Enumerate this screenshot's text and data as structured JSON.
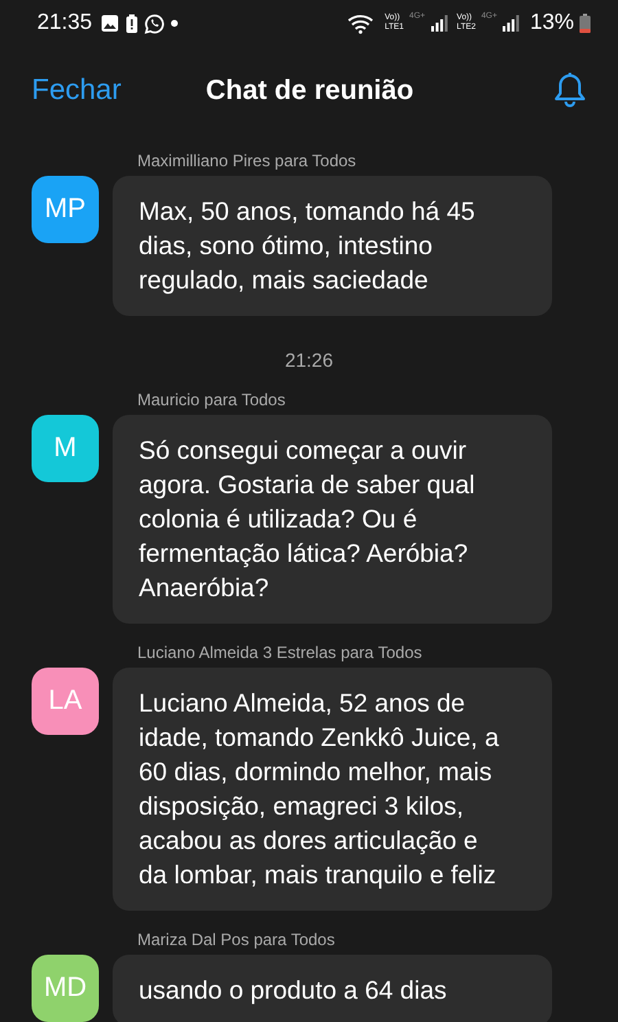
{
  "status_bar": {
    "time": "21:35",
    "network": [
      {
        "volte": "Vo))",
        "lte": "LTE1",
        "gen": "4G+"
      },
      {
        "volte": "Vo))",
        "lte": "LTE2",
        "gen": "4G+"
      }
    ],
    "battery": "13%"
  },
  "header": {
    "close": "Fechar",
    "title": "Chat de reunião"
  },
  "feed": [
    {
      "kind": "message",
      "sender": "Maximilliano Pires para Todos",
      "initials": "MP",
      "color": "#1aa3f5",
      "text": "Max, 50 anos, tomando há 45 dias, sono ótimo, intestino regulado, mais saciedade"
    },
    {
      "kind": "time",
      "text": "21:26"
    },
    {
      "kind": "message",
      "sender": "Mauricio para Todos",
      "initials": "M",
      "color": "#14c8d8",
      "text": "Só consegui começar a ouvir agora. Gostaria de saber qual colonia é utilizada? Ou é fermentação lática? Aeróbia? Anaeróbia?"
    },
    {
      "kind": "message",
      "sender": "Luciano Almeida 3 Estrelas para Todos",
      "initials": "LA",
      "color": "#f88fb8",
      "text": "Luciano Almeida, 52 anos de idade, tomando Zenkkô Juice, a 60 dias, dormindo melhor, mais disposição, emagreci 3 kilos, acabou as dores articulação e da lombar, mais tranquilo e feliz"
    },
    {
      "kind": "message",
      "sender": "Mariza Dal Pos para Todos",
      "initials": "MD",
      "color": "#8fd26c",
      "text": "usando o produto a 64 dias"
    }
  ]
}
